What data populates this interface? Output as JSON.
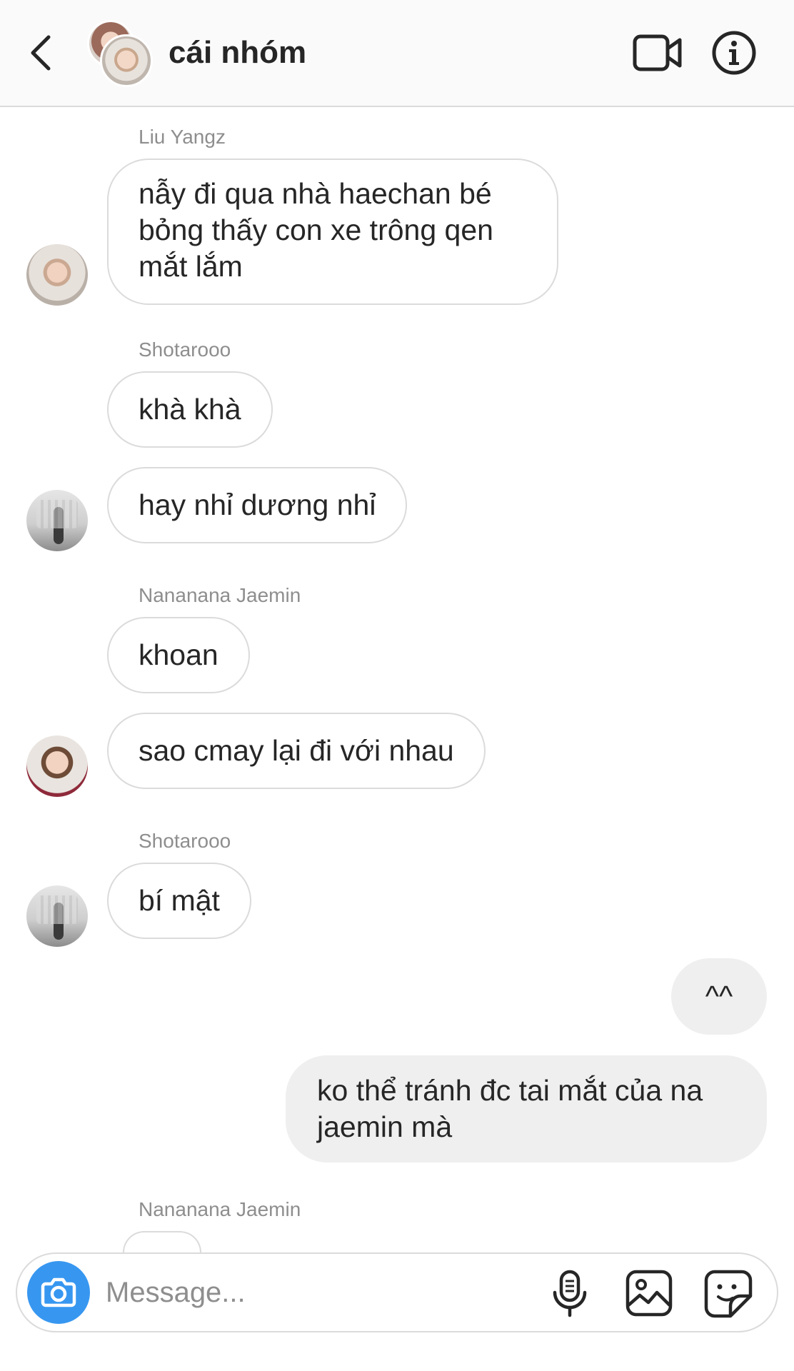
{
  "header": {
    "title": "cái nhóm",
    "icons": [
      "chevron-left-icon",
      "group-avatar",
      "video-call-icon",
      "info-icon"
    ]
  },
  "messages": [
    {
      "sender": "Liu Yangz",
      "text_lines": [
        "nẫy đi qua nhà haechan bé",
        "bỏng thấy con xe trông qen",
        "mắt lắm"
      ]
    },
    {
      "sender": "Shotarooo",
      "text": "khà khà"
    },
    {
      "text": "hay nhỉ dương nhỉ"
    },
    {
      "sender": "Nananana Jaemin",
      "text": "khoan"
    },
    {
      "text": "sao cmay lại đi với nhau"
    },
    {
      "sender": "Shotarooo",
      "text": "bí mật"
    },
    {
      "own": true,
      "text": "^^"
    },
    {
      "own": true,
      "text_lines": [
        "ko thể tránh đc tai mắt của na",
        "jaemin mà"
      ]
    },
    {
      "sender": "Nananana Jaemin"
    }
  ],
  "composer": {
    "placeholder": "Message...",
    "icons": [
      "camera-icon",
      "microphone-icon",
      "gallery-icon",
      "sticker-icon"
    ],
    "accent_color": "#3797f0"
  }
}
